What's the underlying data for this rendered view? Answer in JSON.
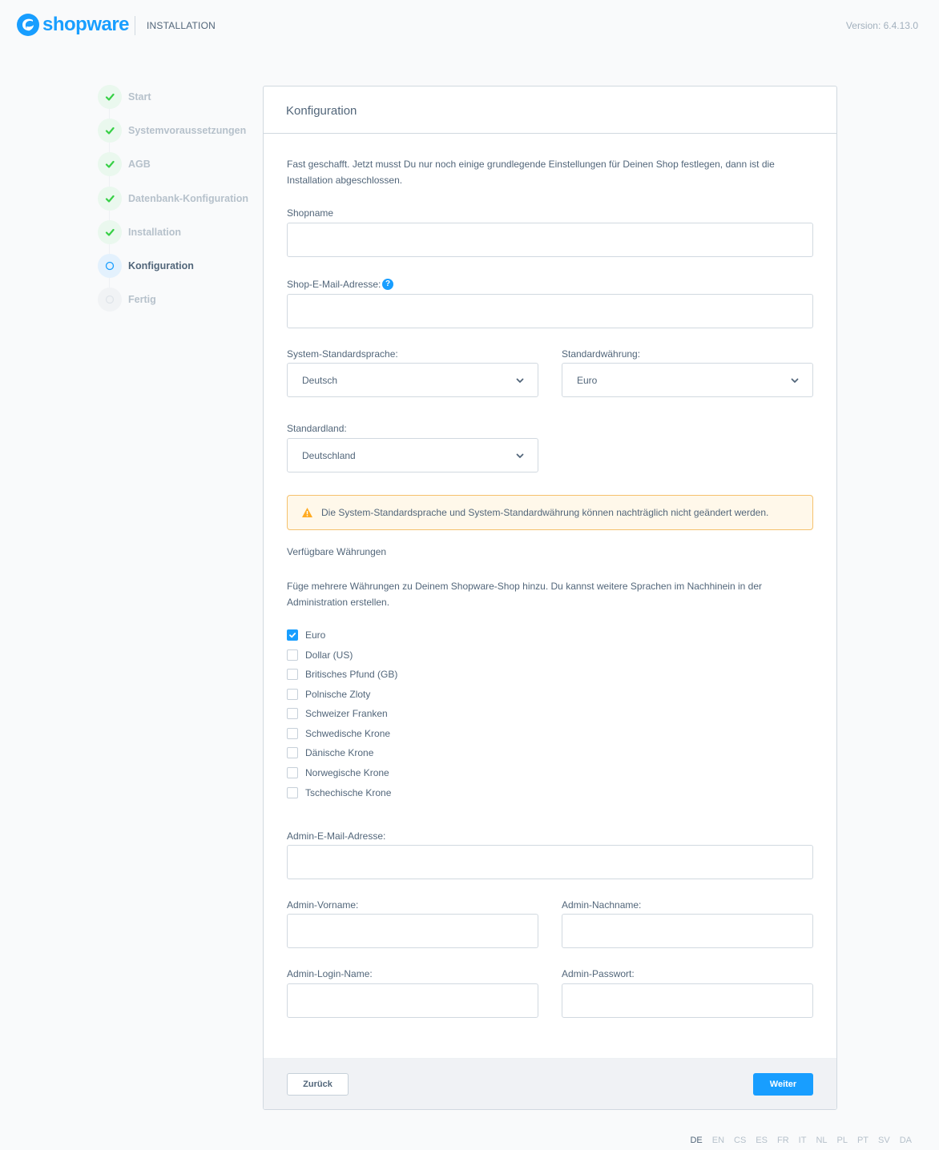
{
  "header": {
    "brand": "shopware",
    "title": "INSTALLATION",
    "version": "Version: 6.4.13.0"
  },
  "steps": [
    {
      "label": "Start",
      "state": "done"
    },
    {
      "label": "Systemvoraussetzungen",
      "state": "done"
    },
    {
      "label": "AGB",
      "state": "done"
    },
    {
      "label": "Datenbank-Konfiguration",
      "state": "done"
    },
    {
      "label": "Installation",
      "state": "done"
    },
    {
      "label": "Konfiguration",
      "state": "active"
    },
    {
      "label": "Fertig",
      "state": "pending"
    }
  ],
  "card": {
    "title": "Konfiguration",
    "intro": "Fast geschafft. Jetzt musst Du nur noch einige grundlegende Einstellungen für Deinen Shop festlegen, dann ist die Installation abgeschlossen."
  },
  "form": {
    "shopname_label": "Shopname",
    "shopname_value": "",
    "shop_email_label": "Shop-E-Mail-Adresse:",
    "shop_email_value": "",
    "language_label": "System-Standardsprache:",
    "language_value": "Deutsch",
    "currency_label": "Standardwährung:",
    "currency_value": "Euro",
    "country_label": "Standardland:",
    "country_value": "Deutschland",
    "alert": "Die System-Standardsprache und System-Standardwährung können nachträglich nicht geändert werden.",
    "currencies_title": "Verfügbare Währungen",
    "currencies_desc": "Füge mehrere Währungen zu Deinem Shopware-Shop hinzu. Du kannst weitere Sprachen im Nachhinein in der Administration erstellen.",
    "currencies": [
      {
        "label": "Euro",
        "checked": true
      },
      {
        "label": "Dollar (US)",
        "checked": false
      },
      {
        "label": "Britisches Pfund (GB)",
        "checked": false
      },
      {
        "label": "Polnische Zloty",
        "checked": false
      },
      {
        "label": "Schweizer Franken",
        "checked": false
      },
      {
        "label": "Schwedische Krone",
        "checked": false
      },
      {
        "label": "Dänische Krone",
        "checked": false
      },
      {
        "label": "Norwegische Krone",
        "checked": false
      },
      {
        "label": "Tschechische Krone",
        "checked": false
      }
    ],
    "admin_email_label": "Admin-E-Mail-Adresse:",
    "admin_firstname_label": "Admin-Vorname:",
    "admin_lastname_label": "Admin-Nachname:",
    "admin_login_label": "Admin-Login-Name:",
    "admin_password_label": "Admin-Passwort:"
  },
  "footer": {
    "back_label": "Zurück",
    "next_label": "Weiter"
  },
  "languages": [
    {
      "code": "DE",
      "active": true
    },
    {
      "code": "EN",
      "active": false
    },
    {
      "code": "CS",
      "active": false
    },
    {
      "code": "ES",
      "active": false
    },
    {
      "code": "FR",
      "active": false
    },
    {
      "code": "IT",
      "active": false
    },
    {
      "code": "NL",
      "active": false
    },
    {
      "code": "PL",
      "active": false
    },
    {
      "code": "PT",
      "active": false
    },
    {
      "code": "SV",
      "active": false
    },
    {
      "code": "DA",
      "active": false
    }
  ],
  "colors": {
    "brand": "#189eff",
    "done": "#37d046",
    "warning": "#ffab22"
  },
  "icons": {
    "step_done": "check-icon",
    "step_active": "circle-icon",
    "help": "question-icon",
    "select": "chevron-down-icon",
    "alert": "warning-icon"
  }
}
